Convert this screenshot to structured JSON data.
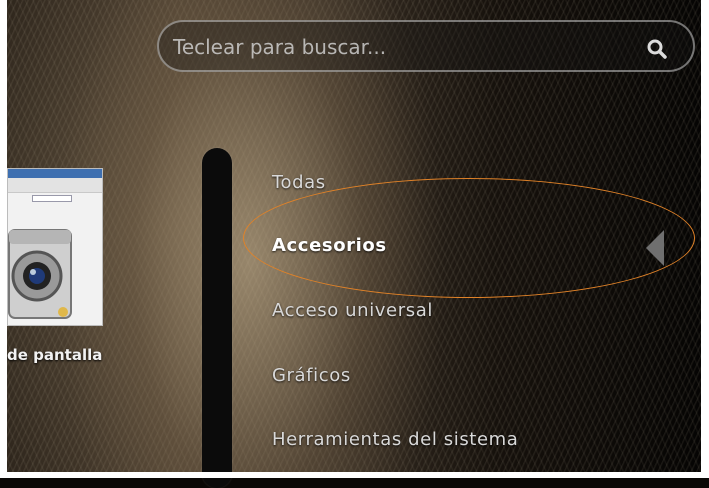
{
  "search": {
    "placeholder": "Teclear para buscar..."
  },
  "window_preview": {
    "caption": "de pantalla"
  },
  "categories": [
    {
      "label": "Todas"
    },
    {
      "label": "Accesorios"
    },
    {
      "label": "Acceso universal"
    },
    {
      "label": "Gráficos"
    },
    {
      "label": "Herramientas del sistema"
    }
  ],
  "selected_category": "Accesorios",
  "colors": {
    "annotation_ellipse": "#e08228",
    "text": "#d9d9d9",
    "selected_text": "#ffffff"
  },
  "icons": {
    "search": "search-icon",
    "expand": "arrow-left-icon",
    "app": "camera-icon"
  }
}
